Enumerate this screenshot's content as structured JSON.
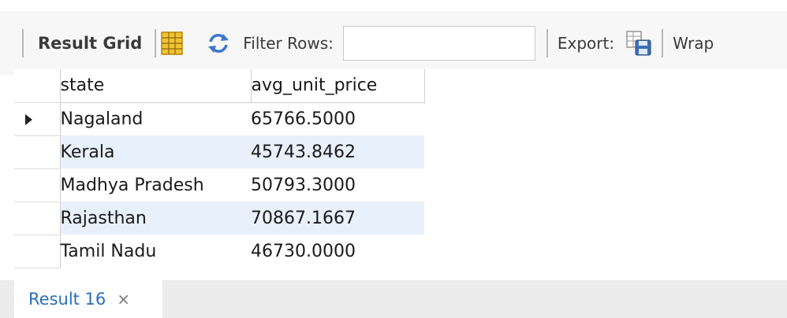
{
  "toolbar": {
    "result_grid_label": "Result Grid",
    "filter_label": "Filter Rows:",
    "filter_value": "",
    "export_label": "Export:",
    "wrap_label": "Wrap",
    "icons": [
      "grid-layout-icon",
      "refresh-icon",
      "export-save-icon"
    ]
  },
  "table": {
    "columns": [
      "state",
      "avg_unit_price"
    ],
    "rows": [
      {
        "state": "Nagaland",
        "avg_unit_price": "65766.5000"
      },
      {
        "state": "Kerala",
        "avg_unit_price": "45743.8462"
      },
      {
        "state": "Madhya Pradesh",
        "avg_unit_price": "50793.3000"
      },
      {
        "state": "Rajasthan",
        "avg_unit_price": "70867.1667"
      },
      {
        "state": "Tamil Nadu",
        "avg_unit_price": "46730.0000"
      }
    ],
    "current_row_indicator": "row-pointer-icon"
  },
  "result_tab": {
    "label": "Result 16",
    "close": "×"
  },
  "colors": {
    "tab_text": "#2a6ebb",
    "alt_row": "#e8f0fb",
    "grid_icon": "#f1c232",
    "refresh_icon": "#3c78c8"
  }
}
